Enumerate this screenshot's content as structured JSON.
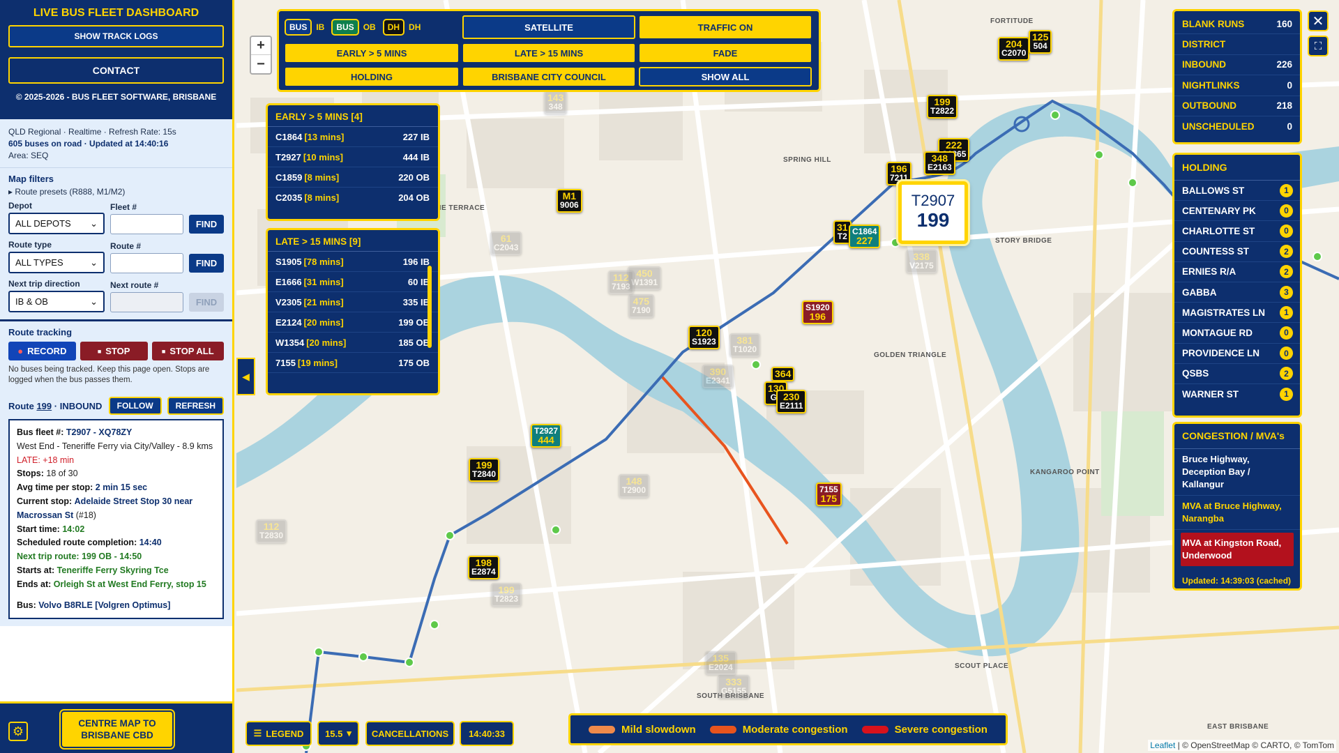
{
  "sidebar": {
    "title": "LIVE BUS FLEET DASHBOARD",
    "show_track_logs": "SHOW TRACK LOGS",
    "contact": "CONTACT",
    "copyright": "© 2025-2026 - BUS FLEET SOFTWARE, BRISBANE",
    "info_line1": "QLD Regional · Realtime · Refresh Rate: 15s",
    "info_line2": "605 buses on road · Updated at 14:40:16",
    "info_line3": "Area: SEQ",
    "filters": {
      "title": "Map filters",
      "presets": "▸ Route presets (R888, M1/M2)",
      "depot_label": "Depot",
      "depot_value": "ALL DEPOTS",
      "fleet_label": "Fleet #",
      "find": "FIND",
      "route_type_label": "Route type",
      "route_type_value": "ALL TYPES",
      "route_label": "Route #",
      "next_dir_label": "Next trip direction",
      "next_dir_value": "IB & OB",
      "next_route_label": "Next route #"
    },
    "tracking": {
      "title": "Route tracking",
      "record": "RECORD",
      "stop": "STOP",
      "stop_all": "STOP ALL",
      "note": "No buses being tracked. Keep this page open. Stops are logged when the bus passes them."
    },
    "route": {
      "prefix": "Route ",
      "number": "199",
      "suffix": " · INBOUND",
      "follow": "FOLLOW",
      "refresh": "REFRESH"
    },
    "details": {
      "fleet_label": "Bus fleet #:",
      "fleet_value": "T2907 - XQ78ZY",
      "description": "West End - Teneriffe Ferry via City/Valley - 8.9 kms",
      "late_label": "LATE:",
      "late_value": "+18 min",
      "stops_label": "Stops:",
      "stops_value": "18 of 30",
      "avg_label": "Avg time per stop:",
      "avg_value": "2 min 15 sec",
      "current_label": "Current stop:",
      "current_value": "Adelaide Street Stop 30 near Macrossan St",
      "current_suffix": " (#18)",
      "start_label": "Start time:",
      "start_value": "14:02",
      "sched_label": "Scheduled route completion:",
      "sched_value": "14:40",
      "next_label": "Next trip route:",
      "next_value": "199 OB - 14:50",
      "starts_label": "Starts at:",
      "starts_value": "Teneriffe Ferry Skyring Tce",
      "ends_label": "Ends at:",
      "ends_value": "Orleigh St at West End Ferry, stop 15",
      "bus_label": "Bus:",
      "bus_value": "Volvo B8RLE [Volgren Optimus]"
    },
    "centre_btn": "CENTRE MAP TO BRISBANE CBD"
  },
  "topbar": {
    "chip_bus_ib": "BUS",
    "chip_ib": "IB",
    "chip_bus_ob": "BUS",
    "chip_ob": "OB",
    "chip_dh": "DH",
    "chip_dh_label": "DH",
    "satellite": "SATELLITE",
    "traffic": "TRAFFIC ON",
    "early": "EARLY > 5 MINS",
    "late": "LATE > 15 MINS",
    "fade": "FADE",
    "holding": "HOLDING",
    "bcc": "BRISBANE CITY COUNCIL",
    "show_all": "SHOW ALL"
  },
  "early": {
    "title": "EARLY > 5 MINS [4]",
    "rows": [
      {
        "fleet": "C1864",
        "mins": "[13 mins]",
        "route": "227 IB"
      },
      {
        "fleet": "T2927",
        "mins": "[10 mins]",
        "route": "444 IB"
      },
      {
        "fleet": "C1859",
        "mins": "[8 mins]",
        "route": "220 OB"
      },
      {
        "fleet": "C2035",
        "mins": "[8 mins]",
        "route": "204 OB"
      }
    ]
  },
  "late": {
    "title": "LATE > 15 MINS [9]",
    "rows": [
      {
        "fleet": "S1905",
        "mins": "[78 mins]",
        "route": "196 IB"
      },
      {
        "fleet": "E1666",
        "mins": "[31 mins]",
        "route": "60 IB"
      },
      {
        "fleet": "V2305",
        "mins": "[21 mins]",
        "route": "335 IB"
      },
      {
        "fleet": "E2124",
        "mins": "[20 mins]",
        "route": "199 OB"
      },
      {
        "fleet": "W1354",
        "mins": "[20 mins]",
        "route": "185 OB"
      },
      {
        "fleet": "7155",
        "mins": "[19 mins]",
        "route": "175 OB"
      }
    ]
  },
  "stats": [
    {
      "label": "BLANK RUNS",
      "value": "160"
    },
    {
      "label": "DISTRICT",
      "value": ""
    },
    {
      "label": "INBOUND",
      "value": "226"
    },
    {
      "label": "NIGHTLINKS",
      "value": "0"
    },
    {
      "label": "OUTBOUND",
      "value": "218"
    },
    {
      "label": "UNSCHEDULED",
      "value": "0"
    }
  ],
  "holding": {
    "title": "HOLDING",
    "rows": [
      {
        "name": "BALLOWS ST",
        "count": "1"
      },
      {
        "name": "CENTENARY PK",
        "count": "0"
      },
      {
        "name": "CHARLOTTE ST",
        "count": "0"
      },
      {
        "name": "COUNTESS ST",
        "count": "2"
      },
      {
        "name": "ERNIES R/A",
        "count": "2"
      },
      {
        "name": "GABBA",
        "count": "3"
      },
      {
        "name": "MAGISTRATES LN",
        "count": "1"
      },
      {
        "name": "MONTAGUE RD",
        "count": "0"
      },
      {
        "name": "PROVIDENCE LN",
        "count": "0"
      },
      {
        "name": "QSBS",
        "count": "2"
      },
      {
        "name": "WARNER ST",
        "count": "1"
      }
    ]
  },
  "congestion": {
    "title": "CONGESTION / MVA's",
    "items": [
      "Bruce Highway, Deception Bay / Kallangur",
      "MVA at Bruce Highway, Narangba",
      "MVA at Kingston Road, Underwood"
    ],
    "updated": "Updated: 14:39:03 (cached)"
  },
  "bottom": {
    "legend": "LEGEND",
    "zoom": "15.5",
    "cancellations": "CANCELLATIONS",
    "time": "14:40:33"
  },
  "cong_legend": {
    "mild": "Mild slowdown",
    "moderate": "Moderate congestion",
    "severe": "Severe congestion",
    "colors": {
      "mild": "#f08a4b",
      "moderate": "#e8541e",
      "severe": "#d8121c"
    }
  },
  "selected_bus": {
    "fleet": "T2907",
    "route": "199"
  },
  "markers": [
    {
      "route": "204",
      "fleet": "C2070",
      "type": "ib"
    },
    {
      "route": "125",
      "fleet": "504",
      "type": "ib"
    },
    {
      "route": "199",
      "fleet": "T2822",
      "type": "ib"
    },
    {
      "route": "222",
      "fleet": "C1865",
      "type": "ib"
    },
    {
      "route": "348",
      "fleet": "E2163",
      "type": "ib"
    },
    {
      "route": "196",
      "fleet": "7211",
      "type": "ib"
    },
    {
      "route": "31",
      "fleet": "T2",
      "type": "ib"
    },
    {
      "route": "C1864",
      "fleet": "227",
      "type": "ob"
    },
    {
      "route": "M1",
      "fleet": "9006",
      "type": "ib"
    },
    {
      "route": "S1920",
      "fleet": "196",
      "type": "late"
    },
    {
      "route": "120",
      "fleet": "S1923",
      "type": "ib"
    },
    {
      "route": "364",
      "fleet": "",
      "type": "ib"
    },
    {
      "route": "130",
      "fleet": "G1",
      "type": "ib"
    },
    {
      "route": "230",
      "fleet": "E2111",
      "type": "ib"
    },
    {
      "route": "T2927",
      "fleet": "444",
      "type": "ob"
    },
    {
      "route": "199",
      "fleet": "T2840",
      "type": "ib"
    },
    {
      "route": "7155",
      "fleet": "175",
      "type": "late"
    },
    {
      "route": "198",
      "fleet": "E2874",
      "type": "ib"
    }
  ],
  "faded_markers": [
    {
      "route": "C2043",
      "fleet": "61"
    },
    {
      "route": "T1020",
      "fleet": "381"
    },
    {
      "route": "V2175",
      "fleet": "338"
    },
    {
      "route": "W1391",
      "fleet": "450"
    },
    {
      "route": "7193",
      "fleet": "112"
    },
    {
      "route": "T2830",
      "fleet": "112"
    },
    {
      "route": "7190",
      "fleet": "475"
    },
    {
      "route": "E2341",
      "fleet": "390"
    },
    {
      "route": "T2900",
      "fleet": "148"
    },
    {
      "route": "T2823",
      "fleet": "199"
    },
    {
      "route": "G5155",
      "fleet": "333"
    },
    {
      "route": "E2024",
      "fleet": "135"
    },
    {
      "route": "348",
      "fleet": "143"
    }
  ],
  "map_labels": [
    "SPRING HILL",
    "PETRIE TERRACE",
    "FORTITUDE",
    "GOLDEN TRIANGLE",
    "KANGAROO POINT",
    "SOUTH BRISBANE",
    "EAST BRISBANE",
    "SCOUT PLACE",
    "STORY BRIDGE"
  ],
  "attribution": {
    "leaflet": "Leaflet",
    "rest": " | © OpenStreetMap © CARTO, © TomTom"
  }
}
